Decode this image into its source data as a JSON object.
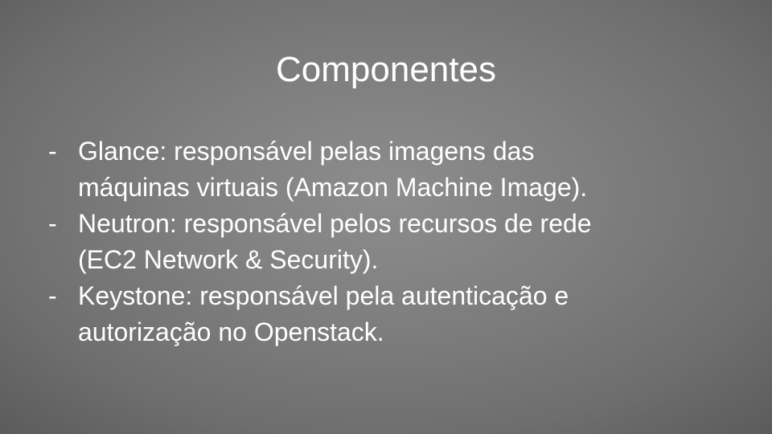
{
  "slide": {
    "title": "Componentes",
    "bullets": [
      {
        "marker": "-",
        "line1": "Glance: responsável pelas imagens das",
        "line2": "máquinas virtuais (Amazon Machine Image)."
      },
      {
        "marker": "-",
        "line1": "Neutron: responsável pelos recursos de rede",
        "line2": "(EC2 Network & Security)."
      },
      {
        "marker": "-",
        "line1": "Keystone: responsável pela autenticação e",
        "line2": "autorização no Openstack."
      }
    ]
  }
}
